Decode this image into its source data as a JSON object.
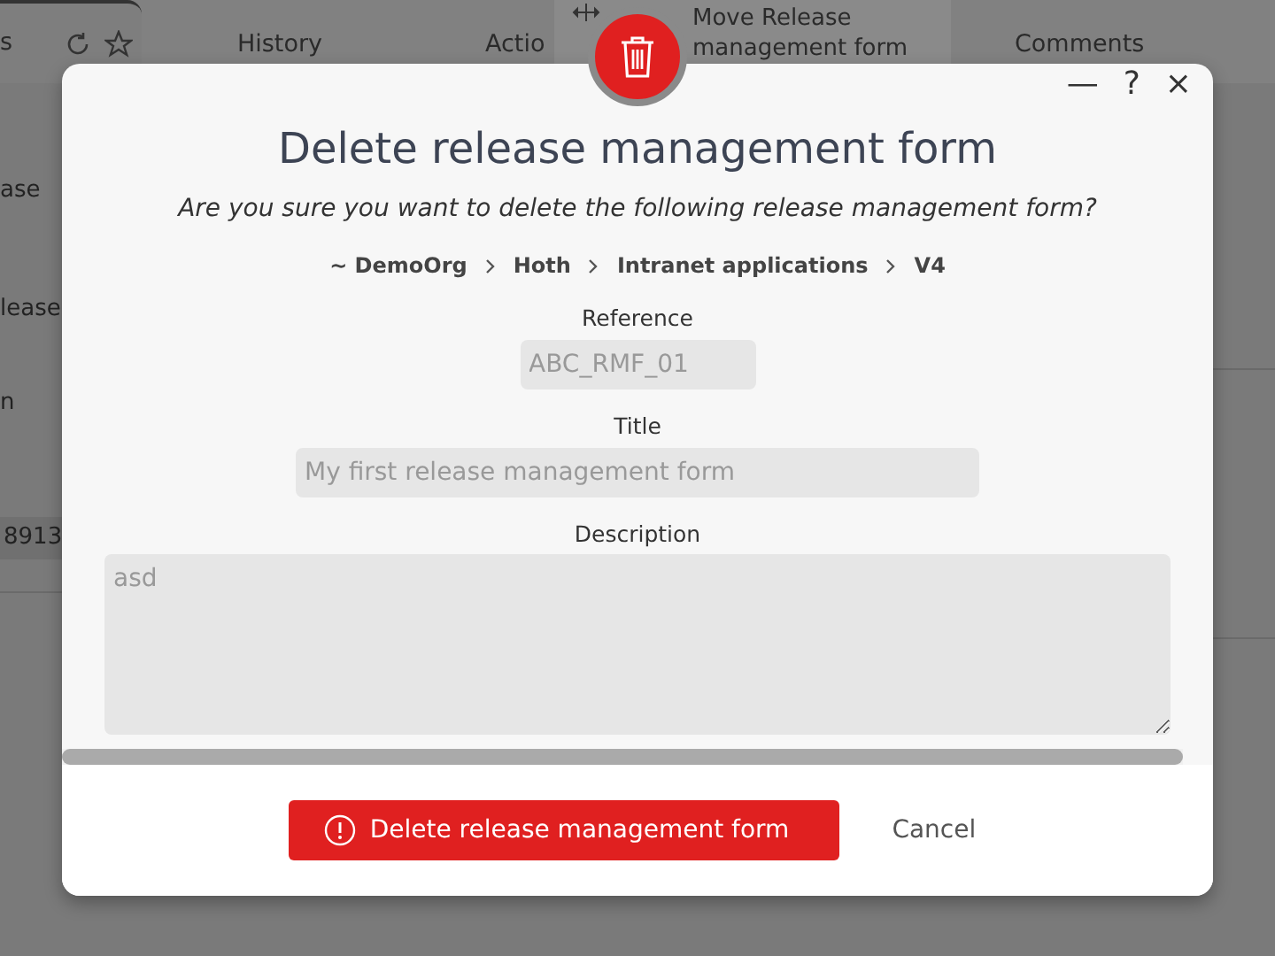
{
  "background": {
    "tabs": [
      {
        "label": "s",
        "selected": true
      },
      {
        "label": "History",
        "selected": false
      },
      {
        "label": "Actio",
        "selected": false
      },
      {
        "label": "Comments",
        "selected": false
      }
    ],
    "menu_item": "Move Release management form",
    "side_texts": [
      "ase",
      "lease",
      "n",
      "8913"
    ]
  },
  "dialog": {
    "window_controls": [
      "—",
      "?",
      "×"
    ],
    "title": "Delete release management form",
    "question": "Are you sure you want to delete the following release management form?",
    "breadcrumb": [
      "~ DemoOrg",
      "Hoth",
      "Intranet applications",
      "V4"
    ],
    "fields": [
      {
        "kind": "input",
        "label": "Reference",
        "value": "ABC_RMF_01"
      },
      {
        "kind": "input",
        "label": "Title",
        "value": "My first release management form"
      },
      {
        "kind": "textarea",
        "label": "Description",
        "value": "asd"
      }
    ],
    "delete_button": "Delete release management form",
    "cancel_button": "Cancel"
  }
}
